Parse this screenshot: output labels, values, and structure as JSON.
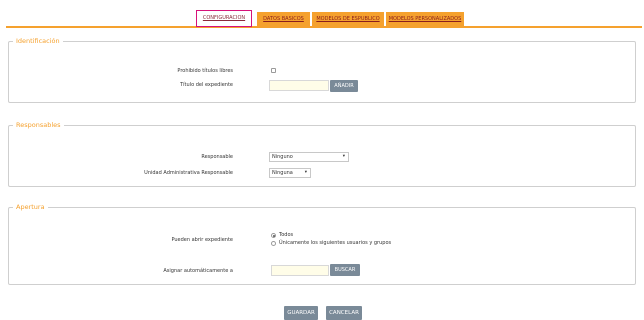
{
  "tabs": [
    {
      "label": "CONFIGURACION",
      "active": true
    },
    {
      "label": "DATOS BASICOS",
      "active": false
    },
    {
      "label": "MODELOS DE ESPUBLICO",
      "active": false
    },
    {
      "label": "MODELOS PERSONALIZADOS",
      "active": false
    }
  ],
  "colors": {
    "accent": "#f5a12e",
    "active_tab_border": "#d6127a",
    "button": "#7a8a98",
    "input_bg": "#fffde8"
  },
  "identificacion": {
    "legend": "Identificación",
    "prohibido_label": "Prohibido títulos libres",
    "titulo_label": "Título del expediente",
    "titulo_value": "",
    "anadir_button": "AÑADIR"
  },
  "responsables": {
    "legend": "Responsables",
    "responsable_label": "Responsable",
    "responsable_value": "Ninguno",
    "unidad_label": "Unidad Administrativa Responsable",
    "unidad_value": "Ninguna",
    "dropdown_icon": "▾"
  },
  "apertura": {
    "legend": "Apertura",
    "pueden_label": "Pueden abrir expediente",
    "options": [
      "Todos",
      "Únicamente los siguientes usuarios y grupos"
    ],
    "selected_option": "Todos",
    "asignar_label": "Asignar automáticamente a",
    "asignar_value": "",
    "buscar_button": "BUSCAR"
  },
  "footer": {
    "guardar_button": "GUARDAR",
    "cancelar_button": "CANCELAR"
  }
}
